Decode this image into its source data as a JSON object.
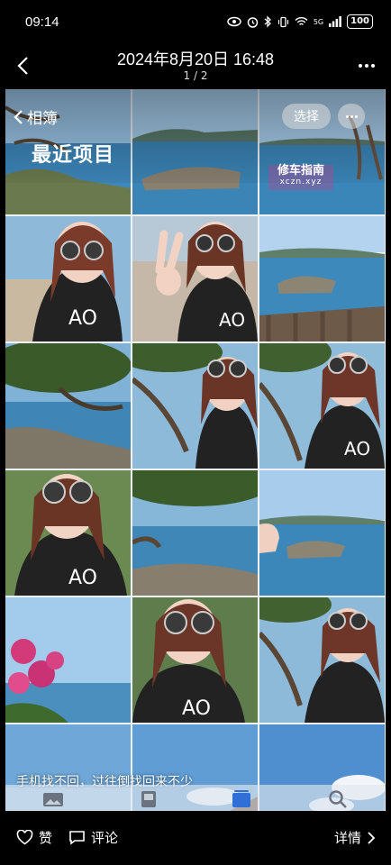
{
  "status_bar": {
    "time": "09:14",
    "network": "5G",
    "battery": "100"
  },
  "header": {
    "title": "2024年8月20日 16:48",
    "subtitle": "1 / 2"
  },
  "screenshot": {
    "album_back_label": "相簿",
    "album_title": "最近项目",
    "select_label": "选择",
    "watermark_line1": "修车指南",
    "watermark_line2": "xczn.xyz",
    "caption": "手机找不回，过往倒找回来不少",
    "tiles": [
      {
        "kind": "sea"
      },
      {
        "kind": "sea-rocks"
      },
      {
        "kind": "sea-branch"
      },
      {
        "kind": "selfie"
      },
      {
        "kind": "peace-sign"
      },
      {
        "kind": "island-rail"
      },
      {
        "kind": "tree-shore"
      },
      {
        "kind": "selfie-branch"
      },
      {
        "kind": "selfie-branch"
      },
      {
        "kind": "selfie"
      },
      {
        "kind": "tree-shore"
      },
      {
        "kind": "sea-rocks"
      },
      {
        "kind": "flowers"
      },
      {
        "kind": "selfie"
      },
      {
        "kind": "selfie-branch"
      },
      {
        "kind": "sky"
      },
      {
        "kind": "sky"
      },
      {
        "kind": "sky"
      }
    ]
  },
  "bottom_bar": {
    "like_label": "赞",
    "comment_label": "评论",
    "detail_label": "详情"
  },
  "colors": {
    "background": "#000000",
    "sea": "#3f86b8",
    "sky": "#a9cdec",
    "tab_active": "#2f6fd6"
  }
}
